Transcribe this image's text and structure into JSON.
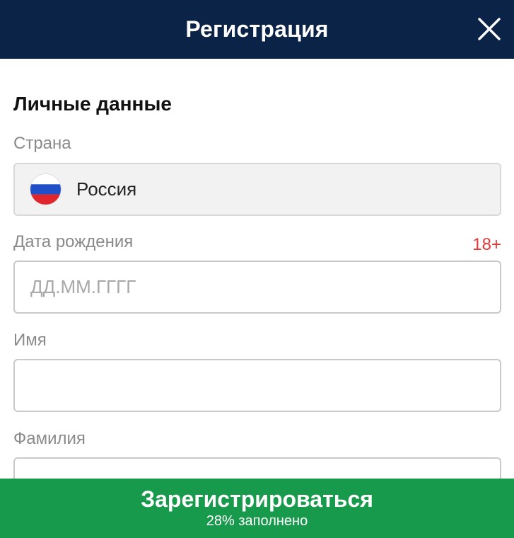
{
  "header": {
    "title": "Регистрация",
    "close_icon": "close-icon"
  },
  "section": {
    "title": "Личные данные"
  },
  "fields": {
    "country": {
      "label": "Страна",
      "value": "Россия",
      "flag_icon": "russia-flag-icon"
    },
    "birthdate": {
      "label": "Дата рождения",
      "age_badge": "18+",
      "placeholder": "ДД.ММ.ГГГГ",
      "value": ""
    },
    "first_name": {
      "label": "Имя",
      "value": ""
    },
    "last_name": {
      "label": "Фамилия",
      "value": ""
    }
  },
  "footer": {
    "register_label": "Зарегистрироваться",
    "progress_text": "28% заполнено",
    "progress_fraction": 0.28
  },
  "colors": {
    "header_bg": "#0b2347",
    "register_bg": "#189a4c",
    "age_badge": "#e53935"
  }
}
